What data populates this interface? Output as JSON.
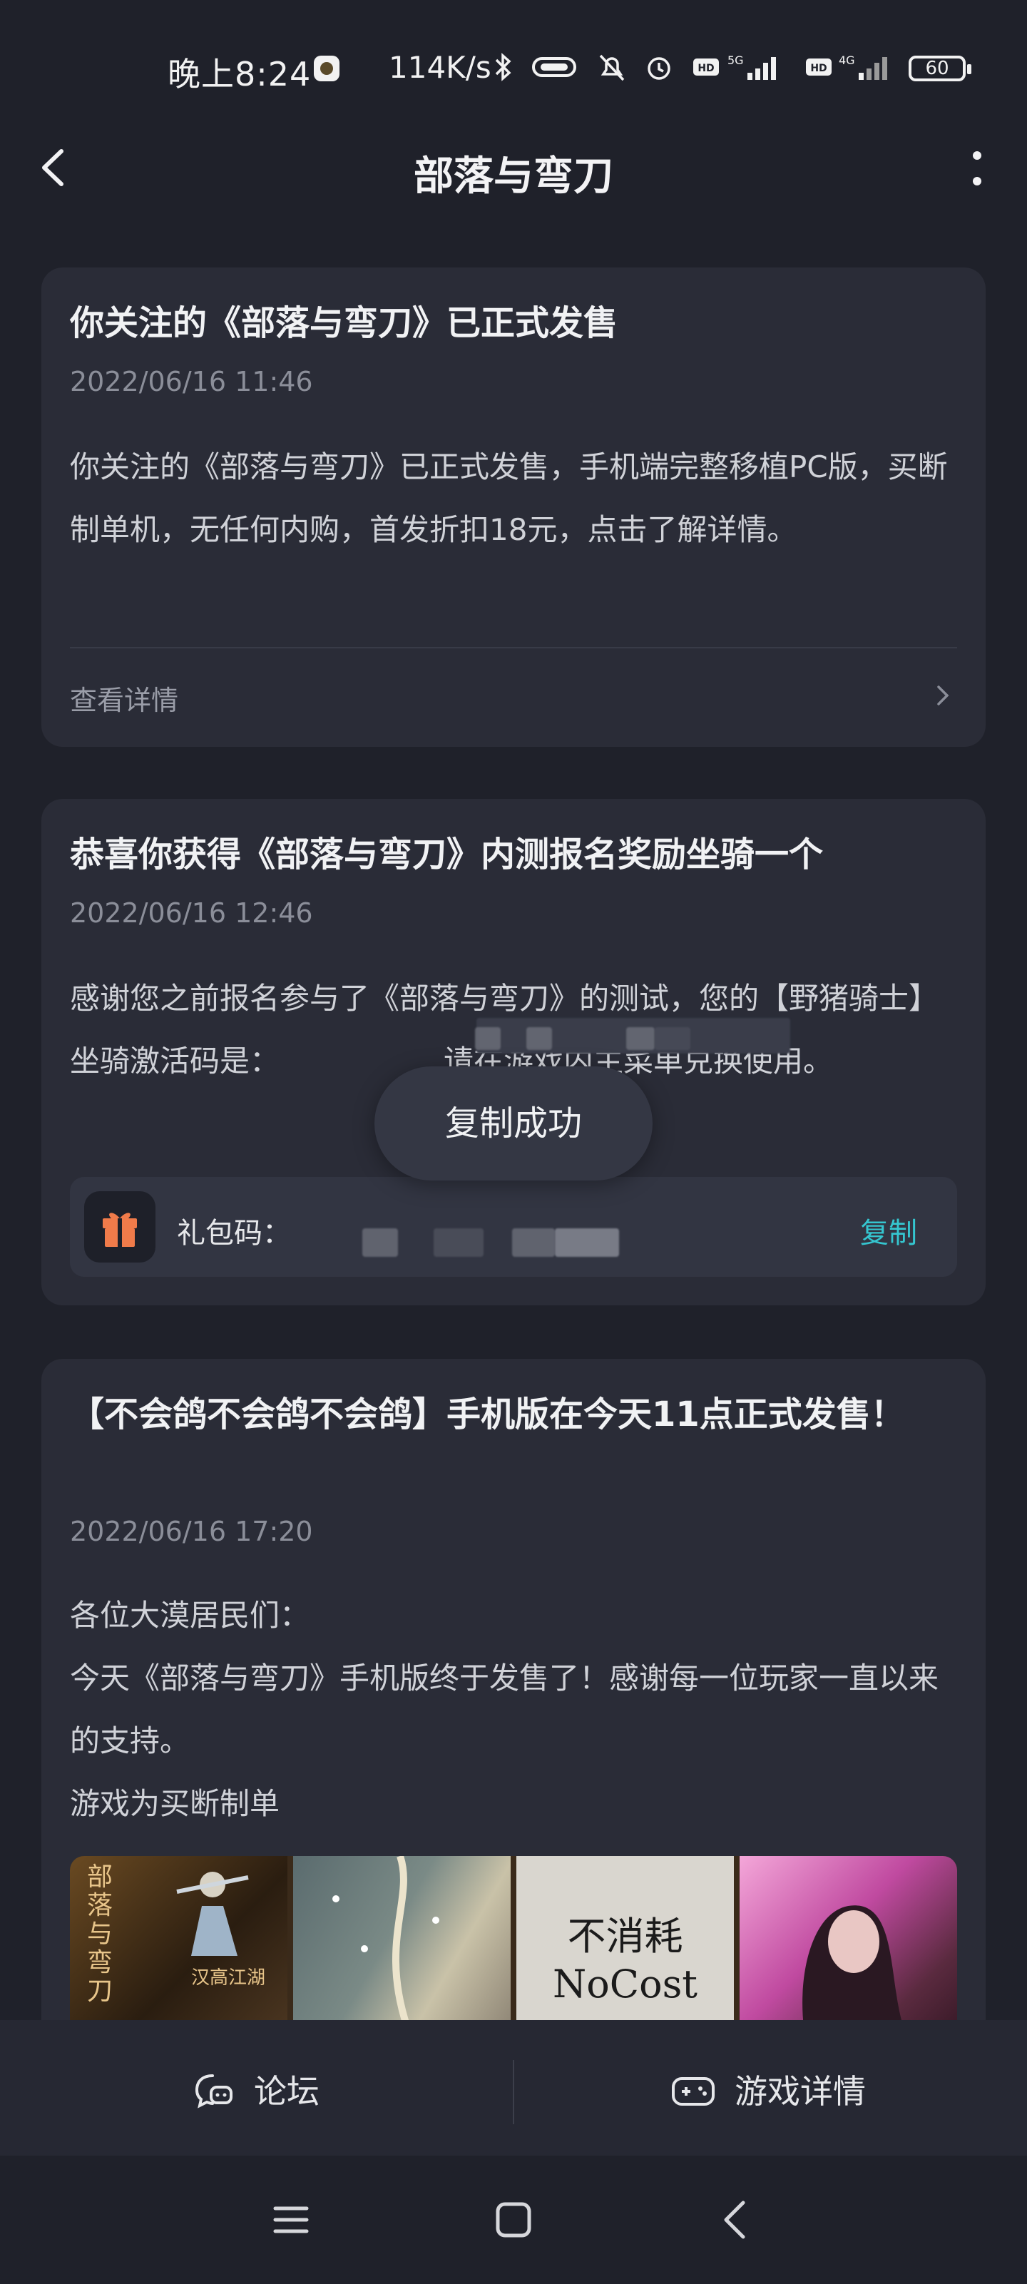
{
  "status_bar": {
    "time": "晚上8:24",
    "net_speed": "114K/s",
    "network_1": "5G",
    "network_2": "4G",
    "battery": "60",
    "icons": [
      "app-notification-icon",
      "bluetooth-icon",
      "vibrate-icon",
      "mute-bell-icon",
      "alarm-icon",
      "hd-icon",
      "signal-icon",
      "hd-icon",
      "signal-icon",
      "battery-icon"
    ]
  },
  "header": {
    "title": "部落与弯刀"
  },
  "cards": [
    {
      "title": "你关注的《部落与弯刀》已正式发售",
      "date": "2022/06/16 11:46",
      "body": "你关注的《部落与弯刀》已正式发售，手机端完整移植PC版，买断制单机，无任何内购，首发折扣18元，点击了解详情。",
      "detail_label": "查看详情"
    },
    {
      "title": "恭喜你获得《部落与弯刀》内测报名奖励坐骑一个",
      "date": "2022/06/16 12:46",
      "body_line1": "感谢您之前报名参与了《部落与弯刀》的测试，您的【野猪骑士】坐骑激活码是：",
      "body_line2": "请在游戏内主菜单兑换使用。",
      "gift_label": "礼包码：",
      "copy_label": "复制"
    },
    {
      "title": "【不会鸽不会鸽不会鸽】手机版在今天11点正式发售！",
      "date": "2022/06/16 17:20",
      "body_lines": [
        "各位大漠居民们：",
        "今天《部落与弯刀》手机版终于发售了！感谢每一位玩家一直以来的支持。",
        "游戏为买断制单"
      ],
      "images": [
        {
          "caption": "部落与弯刀",
          "sub": "汉高江湖"
        },
        {
          "caption": ""
        },
        {
          "caption": "不消耗",
          "sub": "NoCost"
        },
        {
          "caption": ""
        }
      ]
    }
  ],
  "toast": {
    "text": "复制成功"
  },
  "bottom_tabs": {
    "forum": "论坛",
    "game_details": "游戏详情"
  }
}
